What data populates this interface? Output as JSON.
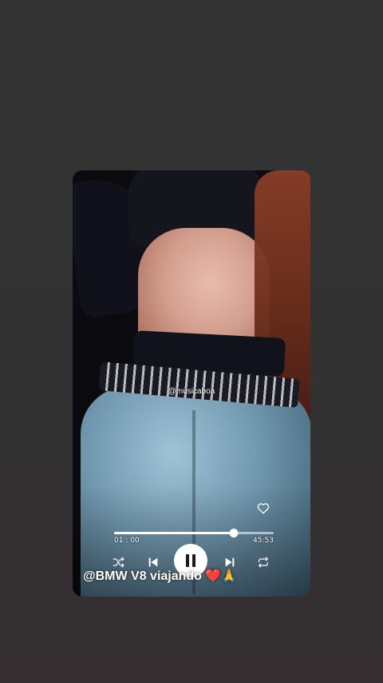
{
  "story": {
    "watermark": "@musicaboa",
    "caption_text": "@BMW V8 viajando",
    "caption_emoji_heart": "❤️",
    "caption_emoji_pray": "🙏"
  },
  "player": {
    "elapsed_time": "01 : 00",
    "total_time": "45:53",
    "progress_fraction": 0.75,
    "state": "playing",
    "liked": false
  },
  "colors": {
    "background": "#333333",
    "controls": "#ffffff",
    "heart_emoji": "#e0242e"
  },
  "icons": {
    "like": "heart-outline-icon",
    "shuffle": "shuffle-icon",
    "previous": "skip-previous-icon",
    "pause": "pause-icon",
    "next": "skip-next-icon",
    "repeat": "repeat-icon"
  }
}
